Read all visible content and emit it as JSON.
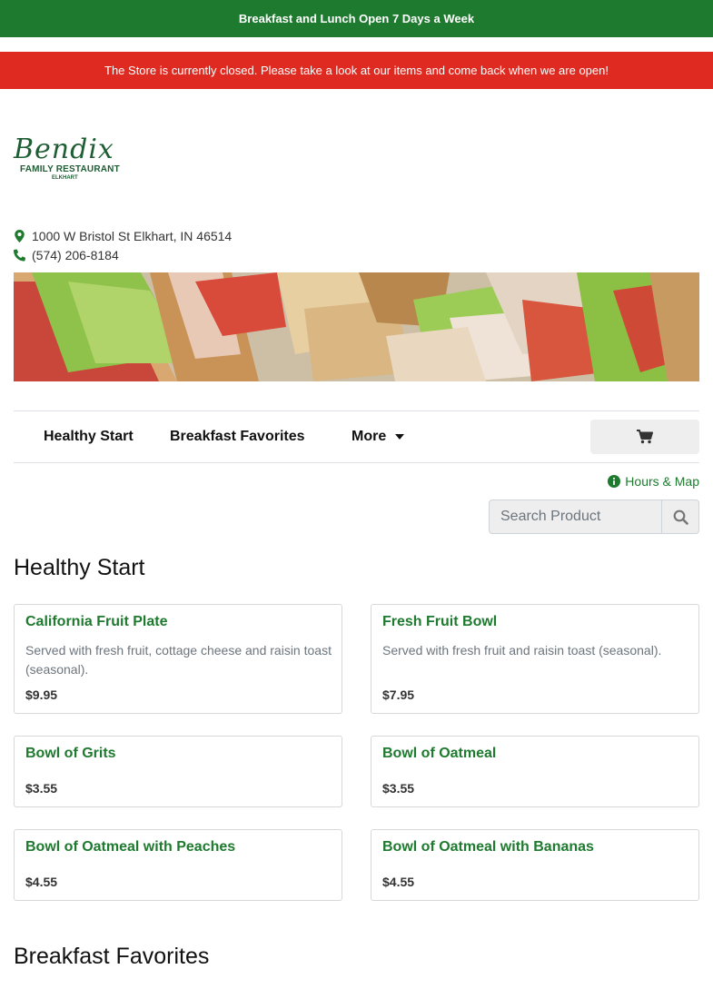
{
  "banners": {
    "top": "Breakfast and Lunch Open 7 Days a Week",
    "closed": "The Store is currently closed. Please take a look at our items and come back when we are open!"
  },
  "logo": {
    "script_text": "Bendix",
    "subtitle": "FAMILY RESTAURANT",
    "location": "ELKHART"
  },
  "contact": {
    "address": "1000 W Bristol St Elkhart, IN 46514",
    "phone": "(574) 206-8184"
  },
  "nav": {
    "items": [
      {
        "label": "Healthy Start"
      },
      {
        "label": "Breakfast Favorites"
      },
      {
        "label": "More"
      }
    ],
    "cart_icon": "shopping-cart-icon"
  },
  "hours_link": {
    "label": "Hours & Map",
    "icon": "info-circle-icon"
  },
  "search": {
    "placeholder": "Search Product",
    "value": "",
    "icon": "search-icon"
  },
  "sections": [
    {
      "title": "Healthy Start",
      "products": [
        {
          "name": "California Fruit Plate",
          "description": "Served with fresh fruit, cottage cheese and raisin toast (seasonal).",
          "price": "$9.95"
        },
        {
          "name": "Fresh Fruit Bowl",
          "description": "Served with fresh fruit and raisin toast (seasonal).",
          "price": "$7.95"
        },
        {
          "name": "Bowl of Grits",
          "description": "",
          "price": "$3.55"
        },
        {
          "name": "Bowl of Oatmeal",
          "description": "",
          "price": "$3.55"
        },
        {
          "name": "Bowl of Oatmeal with Peaches",
          "description": "",
          "price": "$4.55"
        },
        {
          "name": "Bowl of Oatmeal with Bananas",
          "description": "",
          "price": "$4.55"
        }
      ]
    },
    {
      "title": "Breakfast Favorites",
      "products": []
    }
  ],
  "colors": {
    "brand_green": "#1e7a2e",
    "closed_red": "#de2a20",
    "logo_green": "#1f5e34",
    "muted_text": "#6c757d"
  }
}
